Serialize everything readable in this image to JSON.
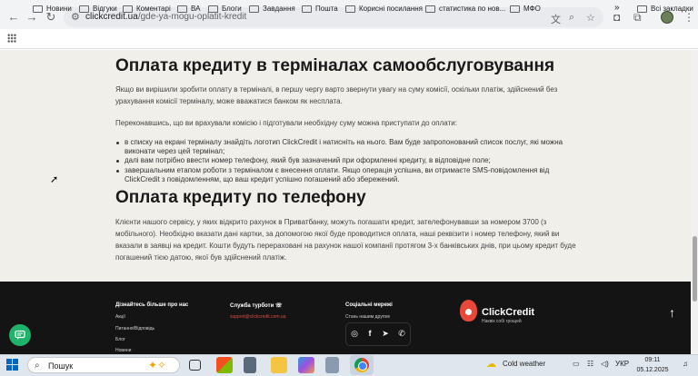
{
  "browser": {
    "url_domain": "clickcredit.ua",
    "url_path": "/gde-ya-mogu-oplatit-kredit",
    "bookmarks": [
      "Новини",
      "Відгуки",
      "Коментарі",
      "ВА",
      "Блоги",
      "Завдання",
      "Пошта",
      "Корисні посилання",
      "статистика по нов...",
      "МФО"
    ],
    "all_bookmarks": "Всі закладки",
    "more": "»"
  },
  "article": {
    "h_terminal": "Оплата кредиту в терміналах самообслуговування",
    "p1": "Якщо ви вирішили зробити оплату в терміналі, в першу чергу варто звернути увагу на суму комісії, оскільки платіж, здійснений без урахування комісії терміналу, може вважатися банком як несплата.",
    "p2": "Переконавшись, що ви врахували комісію і підготували необхідну суму можна приступати до оплати:",
    "bullets": [
      "в списку на екрані терміналу знайдіть логотип ClickCredit і натисніть на нього. Вам буде запропонований список послуг, які можна виконати через цей термінал;",
      "далі вам потрібно ввести номер телефону, який був зазначений при оформленні кредиту, в відповідне поле;",
      "завершальним етапом роботи з терміналом є внесення оплати. Якщо операція успішна, ви отримаєте SMS-повідомлення від ClickCredit з повідомленням, що ваш кредит успішно погашений або збережений."
    ],
    "h_phone": "Оплата кредиту по телефону",
    "p3": "Клієнти нашого сервісу, у яких відкрито рахунок в Приватбанку, можуть погашати кредит, зателефонувавши за номером 3700 (з мобільного). Необхідно вказати дані картки, за допомогою якої буде проводитися оплата, наші реквізити і номер телефону, який ви вказали в заявці на кредит. Кошти будуть перераховані на рахунок нашої компанії протягом 3-х банківських днів, при цьому кредит буде погашений тією датою, якої був здійснений платіж."
  },
  "footer": {
    "learn_heading": "Дізнайтесь більше про нас",
    "learn_links": [
      "Акції",
      "Питання/Відповідь",
      "Блог",
      "Новини"
    ],
    "support_heading": "Служба турботи",
    "support_email": "support@clickcredit.com.ua",
    "social_heading": "Соціальні мережі",
    "social_sub": "Стань нашим другом",
    "logo_name": "ClickCredit",
    "logo_tagline": "Наквік собі грощей"
  },
  "taskbar": {
    "search_placeholder": "Пошук",
    "weather": "Cold weather",
    "lang": "УКР",
    "time": "09:11",
    "date": "05.12.2025"
  }
}
